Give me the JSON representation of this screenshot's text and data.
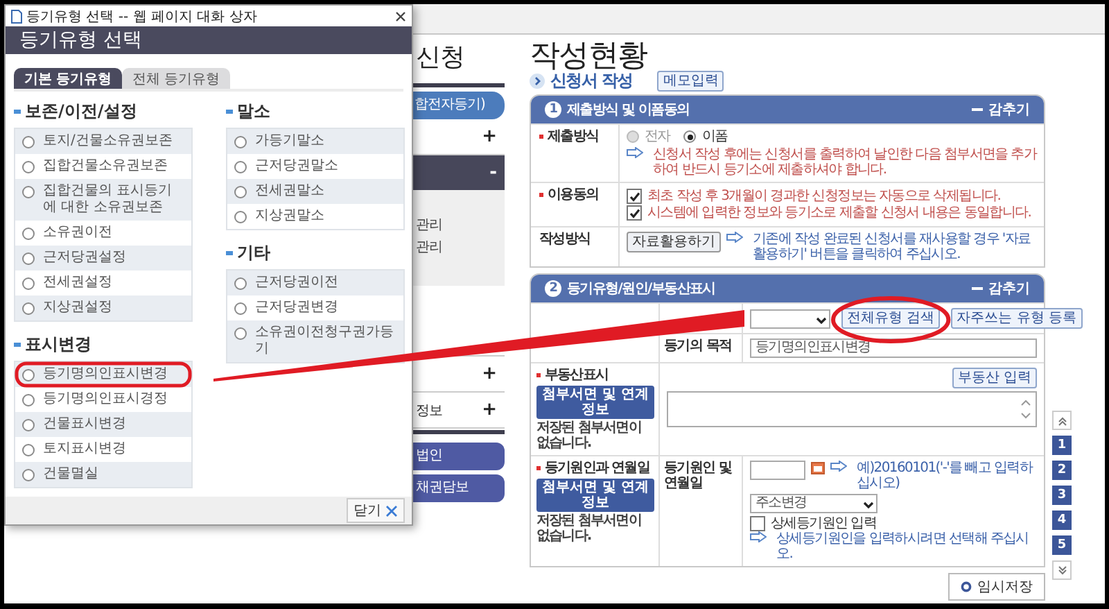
{
  "background_menu": {
    "title": "신청",
    "items": [
      {
        "kind": "tab",
        "label": "합전자등기)"
      },
      {
        "kind": "row",
        "toggle": "+"
      },
      {
        "kind": "bar",
        "toggle": "-"
      },
      {
        "kind": "panel",
        "links": [
          "관리",
          "관리"
        ]
      },
      {
        "kind": "blank"
      },
      {
        "kind": "row",
        "toggle": "+"
      },
      {
        "kind": "row",
        "label": "정보",
        "toggle": "+"
      },
      {
        "kind": "pill",
        "label": "법인"
      },
      {
        "kind": "pill",
        "label": "채권담보"
      }
    ]
  },
  "main": {
    "title": "작성현황",
    "subtitle": "신청서 작성",
    "memo_button": "메모입력",
    "cards": [
      {
        "number": "1",
        "title": "제출방식 및 이폼동의",
        "toggle": "감추기",
        "rows": [
          {
            "kind": "submission",
            "label": "제출방식",
            "required": true,
            "options": [
              {
                "label": "전자",
                "selected": false,
                "disabled": true
              },
              {
                "label": "이폼",
                "selected": true,
                "disabled": false
              }
            ],
            "notice": "신청서 작성 후에는 신청서를 출력하여 날인한 다음 첨부서면을 추가하여 반드시 등기소에 제출하셔야 합니다."
          },
          {
            "kind": "consent",
            "label": "이용동의",
            "required": true,
            "checks": [
              {
                "label": "최초 작성 후 3개월이 경과한 신청정보는 자동으로 삭제됩니다.",
                "checked": true
              },
              {
                "label": "시스템에 입력한 정보와 등기소로 제출할 신청서 내용은 동일합니다.",
                "checked": true
              }
            ]
          },
          {
            "kind": "reuse",
            "label": "작성방식",
            "required": false,
            "button": "자료활용하기",
            "notice": "기존에 작성 완료된 신청서를 재사용할 경우 '자료활용하기' 버튼을 클릭하여 주십시오."
          }
        ]
      },
      {
        "number": "2",
        "title": "등기유형/원인/부동산표시",
        "toggle": "감추기",
        "rows": [
          {
            "kind": "type_search",
            "buttons": [
              "전체유형 검색",
              "자주쓰는 유형 등록"
            ]
          },
          {
            "kind": "field",
            "sublabel": "등기의 목적",
            "value": "등기명의인표시변경"
          },
          {
            "kind": "property",
            "label": "부동산표시",
            "required": true,
            "attach_button": "첨부서면 및 연계정보",
            "attach_note": "저장된 첨부서면이 없습니다.",
            "input_button": "부동산 입력"
          },
          {
            "kind": "cause",
            "label": "등기원인과 연월일",
            "required": true,
            "attach_button": "첨부서면 및 연계정보",
            "attach_note": "저장된 첨부서면이 없습니다.",
            "sublabel": "등기원인 및 연월일",
            "date_hint": "예)20160101('-'를 빼고 입력하십시오)",
            "select_value": "주소변경",
            "detail_check": {
              "label": "상세등기원인 입력",
              "checked": false
            },
            "detail_hint": "상세등기원인을 입력하시려면 선택해 주십시오."
          }
        ]
      }
    ],
    "save_button": "임시저장"
  },
  "side_nav": {
    "pages": [
      "1",
      "2",
      "3",
      "4",
      "5"
    ]
  },
  "dialog": {
    "window_title": "등기유형 선택 -- 웹 페이지 대화 상자",
    "heading": "등기유형 선택",
    "tabs": [
      {
        "label": "기본 등기유형",
        "selected": true
      },
      {
        "label": "전체 등기유형",
        "selected": false
      }
    ],
    "columns": [
      [
        {
          "title": "보존/이전/설정",
          "items": [
            {
              "label": "토지/건물소유권보존",
              "selected": false
            },
            {
              "label": "집합건물소유권보존",
              "selected": false
            },
            {
              "label": "집합건물의 표시등기에 대한 소유권보존",
              "selected": false
            },
            {
              "label": "소유권이전",
              "selected": false
            },
            {
              "label": "근저당권설정",
              "selected": false
            },
            {
              "label": "전세권설정",
              "selected": false
            },
            {
              "label": "지상권설정",
              "selected": false
            }
          ]
        },
        {
          "title": "표시변경",
          "items": [
            {
              "label": "등기명의인표시변경",
              "selected": false
            },
            {
              "label": "등기명의인표시경정",
              "selected": false
            },
            {
              "label": "건물표시변경",
              "selected": false
            },
            {
              "label": "토지표시변경",
              "selected": false
            },
            {
              "label": "건물멸실",
              "selected": false
            }
          ]
        }
      ],
      [
        {
          "title": "말소",
          "items": [
            {
              "label": "가등기말소",
              "selected": false
            },
            {
              "label": "근저당권말소",
              "selected": false
            },
            {
              "label": "전세권말소",
              "selected": false
            },
            {
              "label": "지상권말소",
              "selected": false
            }
          ]
        },
        {
          "title": "기타",
          "items": [
            {
              "label": "근저당권이전",
              "selected": false
            },
            {
              "label": "근저당권변경",
              "selected": false
            },
            {
              "label": "소유권이전청구권가등기",
              "selected": false
            }
          ]
        }
      ]
    ],
    "close_button": "닫기"
  }
}
